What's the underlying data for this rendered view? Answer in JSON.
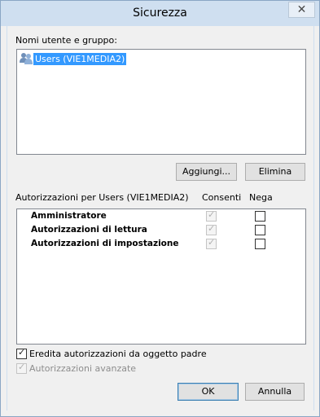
{
  "window": {
    "title": "Sicurezza",
    "close": "✕"
  },
  "users_group": {
    "label": "Nomi utente e gruppo:",
    "items": [
      {
        "name": "Users (VIE1MEDIA2)",
        "selected": true,
        "icon": "users-group-icon"
      }
    ]
  },
  "buttons": {
    "add": "Aggiungi...",
    "remove": "Elimina",
    "ok": "OK",
    "cancel": "Annulla"
  },
  "permissions": {
    "label": "Autorizzazioni per Users (VIE1MEDIA2)",
    "col_allow": "Consenti",
    "col_deny": "Nega",
    "rows": [
      {
        "name": "Amministratore",
        "allow": true,
        "deny": false
      },
      {
        "name": "Autorizzazioni di lettura",
        "allow": true,
        "deny": false
      },
      {
        "name": "Autorizzazioni di impostazione",
        "allow": true,
        "deny": false
      }
    ]
  },
  "options": {
    "inherit_label": "Eredita autorizzazioni da oggetto padre",
    "inherit_checked": true,
    "advanced_label": "Autorizzazioni avanzate",
    "advanced_checked": true,
    "advanced_enabled": false
  },
  "colors": {
    "selection": "#3399ff",
    "titlebar": "#cfdff0"
  }
}
